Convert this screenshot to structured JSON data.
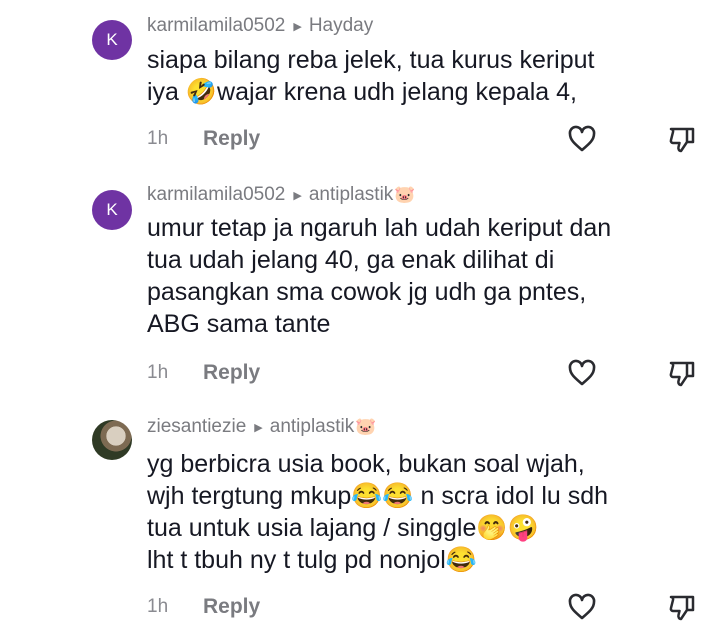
{
  "comments": [
    {
      "avatar_letter": "K",
      "username": "karmilamila0502",
      "reply_to": "Hayday",
      "reply_to_emoji": "",
      "lines": [
        "siapa bilang reba jelek, tua kurus keriput",
        "iya 🤣wajar krena udh jelang kepala 4,"
      ],
      "time": "1h",
      "reply_label": "Reply"
    },
    {
      "avatar_letter": "K",
      "username": "karmilamila0502",
      "reply_to": "antiplastik",
      "reply_to_emoji": "🐷",
      "lines": [
        "umur tetap ja ngaruh lah udah keriput dan",
        "tua udah jelang 40, ga enak dilihat di",
        "pasangkan sma cowok jg udh ga pntes,",
        "ABG sama tante"
      ],
      "time": "1h",
      "reply_label": "Reply"
    },
    {
      "avatar_letter": "",
      "username": "ziesantiezie",
      "reply_to": "antiplastik",
      "reply_to_emoji": "🐷",
      "lines": [
        "yg berbicra usia book, bukan soal wjah,",
        "wjh tergtung mkup😂😂 n scra idol lu sdh",
        "tua untuk usia lajang / singgle🤭🤪",
        "lht t tbuh ny t tulg pd nonjol😂"
      ],
      "time": "1h",
      "reply_label": "Reply"
    }
  ],
  "icons": {
    "reply_arrow": "triangle-right-icon",
    "like": "heart-outline-icon",
    "dislike": "thumbs-down-outline-icon"
  },
  "colors": {
    "avatar_purple": "#6f33a3",
    "text_primary": "#161823",
    "text_secondary": "#7a7b80"
  }
}
